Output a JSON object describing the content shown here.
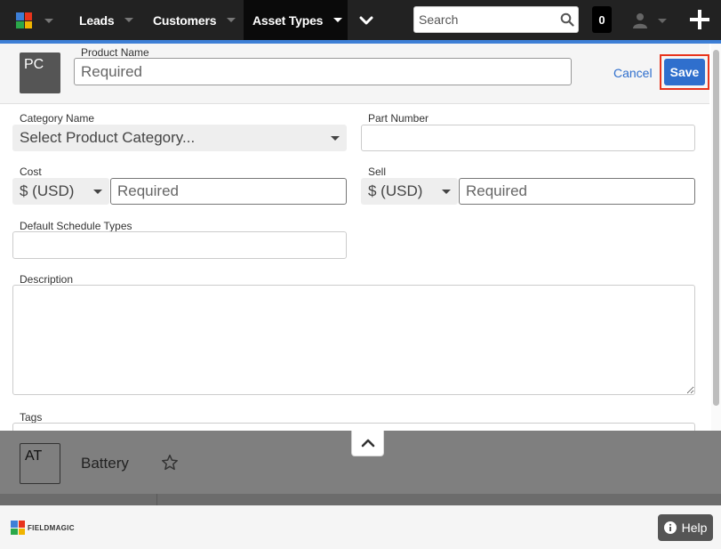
{
  "nav": {
    "logo_icon": "app-logo-icon",
    "items": [
      {
        "label": "Leads"
      },
      {
        "label": "Customers"
      },
      {
        "label": "Asset Types",
        "active": true
      }
    ],
    "search": {
      "placeholder": "Search",
      "value": ""
    },
    "notification_count": "0"
  },
  "header": {
    "avatar_initials": "PC",
    "product_name_label": "Product Name",
    "product_name_placeholder": "Required",
    "cancel_label": "Cancel",
    "save_label": "Save"
  },
  "form": {
    "category": {
      "label": "Category Name",
      "value": "Select Product Category..."
    },
    "part_number": {
      "label": "Part Number",
      "value": ""
    },
    "cost": {
      "label": "Cost",
      "currency": "$ (USD)",
      "placeholder": "Required"
    },
    "sell": {
      "label": "Sell",
      "currency": "$ (USD)",
      "placeholder": "Required"
    },
    "default_schedule_types": {
      "label": "Default Schedule Types",
      "value": ""
    },
    "description": {
      "label": "Description",
      "value": ""
    },
    "tags": {
      "label": "Tags"
    }
  },
  "background_record": {
    "initials": "AT",
    "name": "Battery"
  },
  "footer": {
    "brand": "FIELDMAGIC",
    "help_label": "Help"
  },
  "colors": {
    "accent": "#2f6fcd",
    "nav_bg": "#222222",
    "highlight": "#e8341c"
  }
}
